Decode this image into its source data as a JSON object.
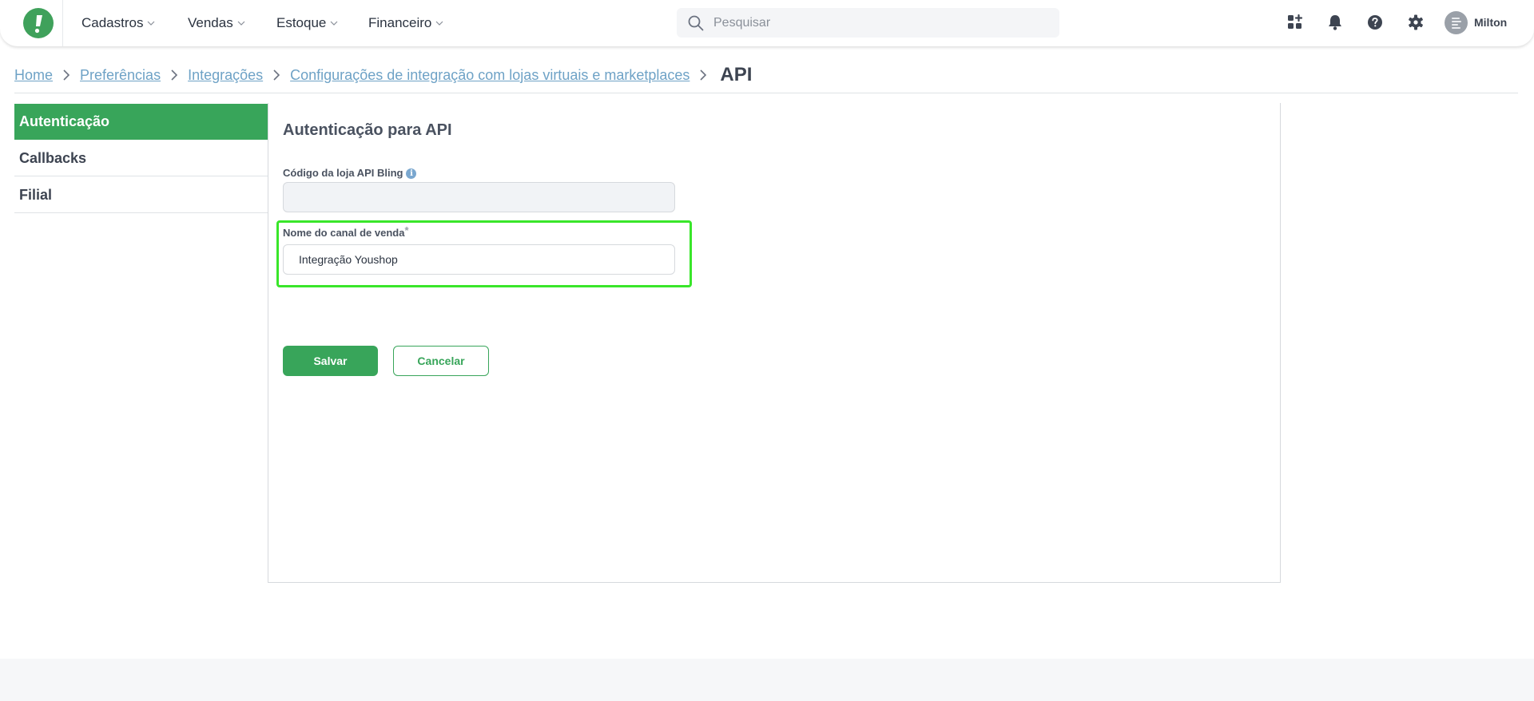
{
  "header": {
    "nav": [
      {
        "label": "Cadastros"
      },
      {
        "label": "Vendas"
      },
      {
        "label": "Estoque"
      },
      {
        "label": "Financeiro"
      }
    ],
    "search_placeholder": "Pesquisar",
    "user_name": "Milton"
  },
  "breadcrumb": {
    "links": [
      "Home",
      "Preferências",
      "Integrações",
      "Configurações de integração com lojas virtuais e marketplaces"
    ],
    "current": "API"
  },
  "sidebar": {
    "items": [
      {
        "label": "Autenticação",
        "active": true
      },
      {
        "label": "Callbacks",
        "active": false
      },
      {
        "label": "Filial",
        "active": false
      }
    ]
  },
  "form": {
    "title": "Autenticação para API",
    "store_code_label": "Código da loja API Bling",
    "store_code_value": "",
    "channel_label": "Nome do canal de venda",
    "channel_required_mark": "*",
    "channel_value": "Integração Youshop",
    "save_label": "Salvar",
    "cancel_label": "Cancelar"
  },
  "colors": {
    "brand_green": "#38a55a",
    "highlight": "#39e62a",
    "link": "#6ea2c6"
  }
}
